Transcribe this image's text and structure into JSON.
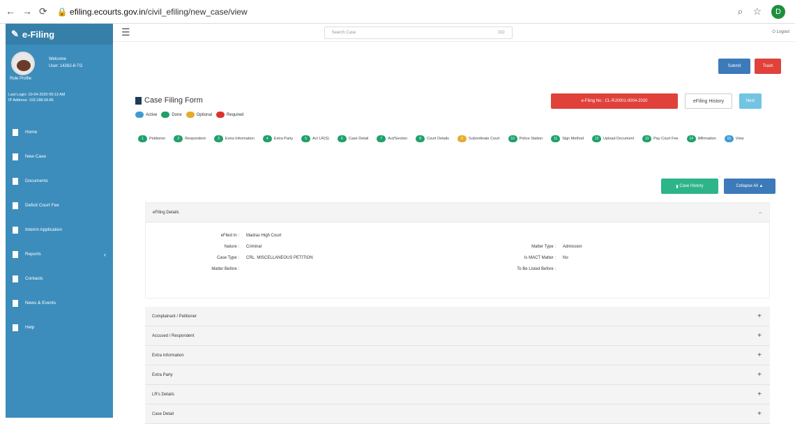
{
  "browser": {
    "url_host": "efiling.ecourts.gov.in",
    "url_path": "/civil_efiling/new_case/view",
    "profile_initial": "D"
  },
  "sidebar": {
    "brand": "e-Filing",
    "welcome": "Welcome",
    "user_id": "User: 14262-8-TG",
    "user_small": "Role Profile",
    "last_login": "Last Login: 10-04-2020 09:13 AM",
    "ip_address": "IP Address: 103.188.69.86",
    "items": [
      {
        "label": "Home",
        "icon": "home-icon"
      },
      {
        "label": "New Case",
        "icon": "pen-icon"
      },
      {
        "label": "Documents",
        "icon": "file-icon"
      },
      {
        "label": "Deficit Court Fee",
        "icon": "rupee-icon"
      },
      {
        "label": "Interim Application",
        "icon": "file-icon"
      },
      {
        "label": "Reports",
        "icon": "table-icon",
        "has_submenu": true
      },
      {
        "label": "Contacts",
        "icon": "user-icon"
      },
      {
        "label": "News & Events",
        "icon": "newspaper-icon"
      },
      {
        "label": "Help",
        "icon": "help-icon"
      }
    ]
  },
  "topnav": {
    "search_placeholder": "Search Case",
    "search_button": "GO",
    "logout": "Logout"
  },
  "actions": {
    "submit": "Submit",
    "trash": "Trash",
    "efiling_no": "e-Filing No : CL-RJ0001-0004-2020",
    "history": "eFiling History",
    "next": "Next"
  },
  "form": {
    "title": "Case Filing Form",
    "legend": [
      {
        "label": "Active",
        "color": "#3e9bd2"
      },
      {
        "label": "Done",
        "color": "#1fa06a"
      },
      {
        "label": "Optional",
        "color": "#e5ab2e"
      },
      {
        "label": "Required",
        "color": "#d9342b"
      }
    ],
    "steps": [
      {
        "num": "1",
        "label": "Petitioner",
        "kind": "g"
      },
      {
        "num": "2",
        "label": "Respondent",
        "kind": "g"
      },
      {
        "num": "3",
        "label": "Extra Information",
        "kind": "g"
      },
      {
        "num": "4",
        "label": "Extra Party",
        "kind": "g"
      },
      {
        "num": "5",
        "label": "Act LR(S)",
        "kind": "g"
      },
      {
        "num": "6",
        "label": "Case Detail",
        "kind": "g"
      },
      {
        "num": "7",
        "label": "Act/Section",
        "kind": "g"
      },
      {
        "num": "8",
        "label": "Court Details",
        "kind": "g"
      },
      {
        "num": "9",
        "label": "Subordinate Court",
        "kind": "y"
      },
      {
        "num": "10",
        "label": "Police Station",
        "kind": "g"
      },
      {
        "num": "11",
        "label": "Sign Method",
        "kind": "g"
      },
      {
        "num": "12",
        "label": "Upload Document",
        "kind": "g"
      },
      {
        "num": "13",
        "label": "Pay Court Fee",
        "kind": "g"
      },
      {
        "num": "14",
        "label": "Affirmation",
        "kind": "g"
      },
      {
        "num": "15",
        "label": "View",
        "kind": "b"
      }
    ],
    "case_history_btn": "Case History",
    "collapse_all_btn": "Collapse All"
  },
  "efiling_details": {
    "title": "eFiling Details",
    "left": [
      {
        "k": "eFiled In :",
        "v": "Madras High Court"
      },
      {
        "k": "Nature :",
        "v": "Criminal"
      },
      {
        "k": "Case Type :",
        "v": "CRL. MISCELLANEOUS PETITION"
      },
      {
        "k": "Matter Before :",
        "v": ""
      }
    ],
    "right": [
      {
        "k": "Matter Type :",
        "v": "Admission"
      },
      {
        "k": "Is MACT Matter :",
        "v": "No"
      },
      {
        "k": "To Be Listed Before :",
        "v": ""
      }
    ]
  },
  "sections": [
    "Complainant / Petitioner",
    "Accused / Respondent",
    "Extra Information",
    "Extra Party",
    "LR's Details",
    "Case Detail"
  ]
}
